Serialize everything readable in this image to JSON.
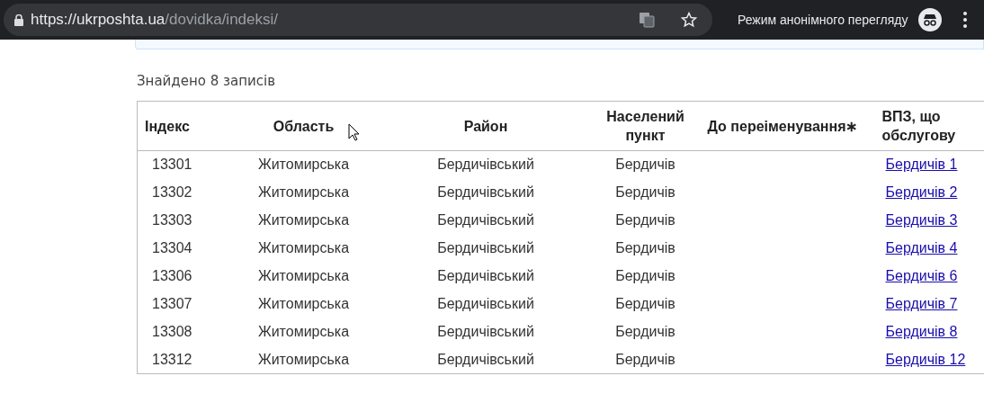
{
  "browser": {
    "url_host": "https://ukrposhta.ua",
    "url_path": "/dovidka/indeksi/",
    "incognito_label": "Режим анонімного перегляду"
  },
  "results": {
    "count_text": "Знайдено 8 записів"
  },
  "table": {
    "columns": [
      "Індекс",
      "Область",
      "Район",
      "Населений пункт",
      "До переіменування∗",
      "ВПЗ, що обслугову"
    ],
    "rows": [
      {
        "index": "13301",
        "region": "Житомирська",
        "district": "Бердичівський",
        "settlement": "Бердичів",
        "office": "Бердичів 1"
      },
      {
        "index": "13302",
        "region": "Житомирська",
        "district": "Бердичівський",
        "settlement": "Бердичів",
        "office": "Бердичів 2"
      },
      {
        "index": "13303",
        "region": "Житомирська",
        "district": "Бердичівський",
        "settlement": "Бердичів",
        "office": "Бердичів 3"
      },
      {
        "index": "13304",
        "region": "Житомирська",
        "district": "Бердичівський",
        "settlement": "Бердичів",
        "office": "Бердичів 4"
      },
      {
        "index": "13306",
        "region": "Житомирська",
        "district": "Бердичівський",
        "settlement": "Бердичів",
        "office": "Бердичів 6"
      },
      {
        "index": "13307",
        "region": "Житомирська",
        "district": "Бердичівський",
        "settlement": "Бердичів",
        "office": "Бердичів 7"
      },
      {
        "index": "13308",
        "region": "Житомирська",
        "district": "Бердичівський",
        "settlement": "Бердичів",
        "office": "Бердичів 8"
      },
      {
        "index": "13312",
        "region": "Житомирська",
        "district": "Бердичівський",
        "settlement": "Бердичів",
        "office": "Бердичів 12"
      }
    ]
  }
}
